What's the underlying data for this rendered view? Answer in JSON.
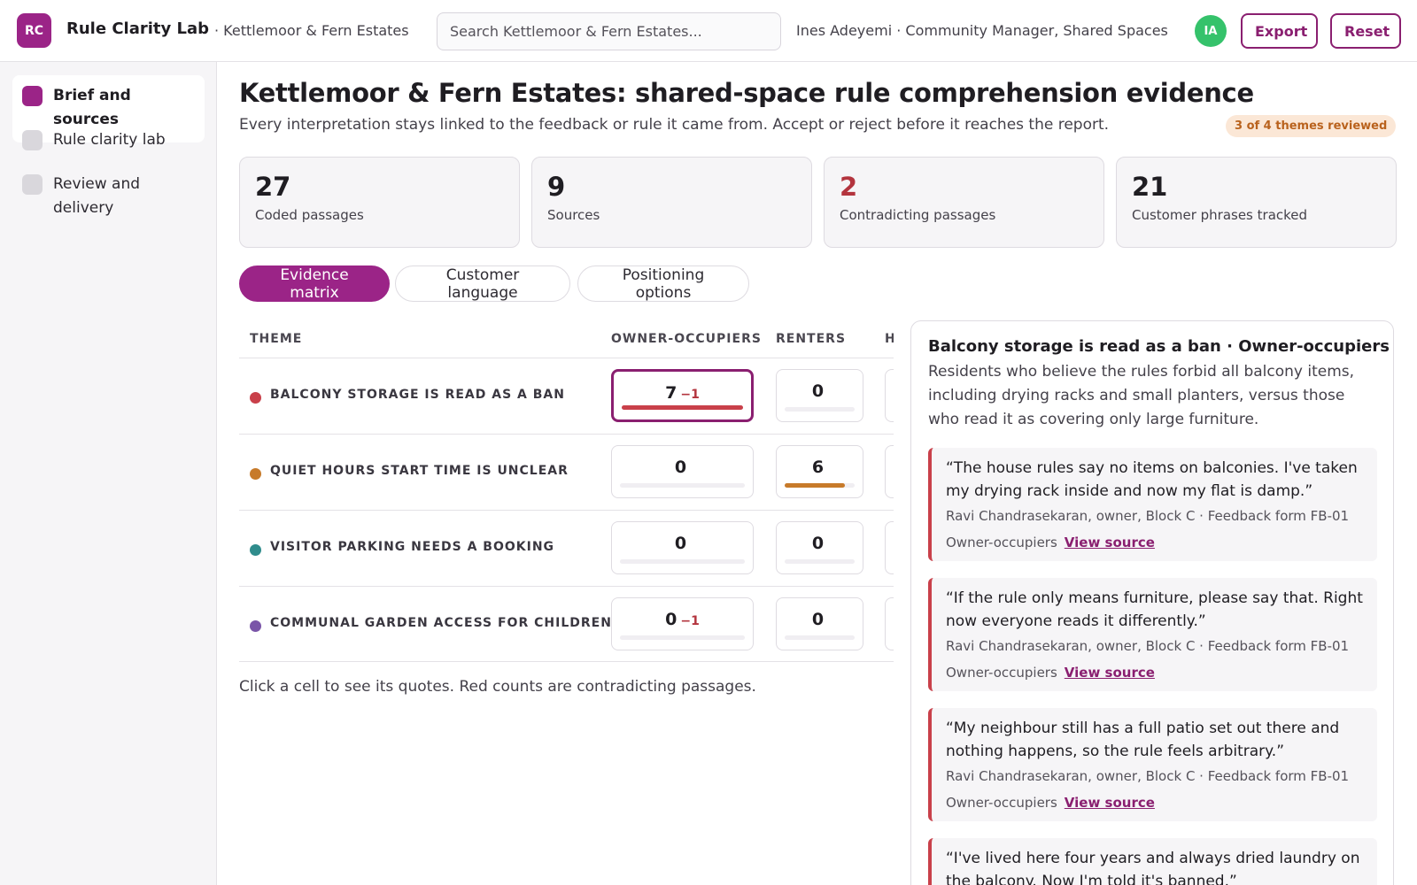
{
  "header": {
    "logo": "RC",
    "app_name": "Rule Clarity Lab",
    "workspace": "· Kettlemoor & Fern Estates",
    "search_placeholder": "Search Kettlemoor & Fern Estates...",
    "user": "Ines Adeyemi · Community Manager, Shared Spaces",
    "avatar": "IA",
    "export_label": "Export",
    "reset_label": "Reset"
  },
  "sidebar": {
    "items": [
      {
        "label": "Brief and sources",
        "active": true
      },
      {
        "label": "Rule clarity lab",
        "active": false
      },
      {
        "label": "Review and delivery",
        "active": false
      }
    ]
  },
  "main": {
    "title": "Kettlemoor & Fern Estates: shared-space rule comprehension evidence",
    "subtitle": "Every interpretation stays linked to the feedback or rule it came from. Accept or reject before it reaches the report.",
    "review_badge": "3 of 4 themes reviewed",
    "stats": [
      {
        "value": "27",
        "label": "Coded passages",
        "highlight": false
      },
      {
        "value": "9",
        "label": "Sources",
        "highlight": false
      },
      {
        "value": "2",
        "label": "Contradicting passages",
        "highlight": true
      },
      {
        "value": "21",
        "label": "Customer phrases tracked",
        "highlight": false
      }
    ],
    "tabs": [
      {
        "label": "Evidence matrix",
        "active": true
      },
      {
        "label": "Customer language",
        "active": false
      },
      {
        "label": "Positioning options",
        "active": false
      }
    ]
  },
  "matrix": {
    "headers": [
      "THEME",
      "OWNER-OCCUPIERS",
      "RENTERS",
      "H"
    ],
    "rows": [
      {
        "theme": "BALCONY STORAGE IS READ AS A BAN",
        "color": "#c9404a",
        "cells": [
          {
            "count": "7",
            "contra": "−1",
            "fill": 1.0,
            "selected": true
          },
          {
            "count": "0",
            "contra": "",
            "fill": 0,
            "selected": false
          }
        ]
      },
      {
        "theme": "QUIET HOURS START TIME IS UNCLEAR",
        "color": "#c77a2a",
        "cells": [
          {
            "count": "0",
            "contra": "",
            "fill": 0,
            "selected": false
          },
          {
            "count": "6",
            "contra": "",
            "fill": 0.86,
            "selected": false
          }
        ]
      },
      {
        "theme": "VISITOR PARKING NEEDS A BOOKING",
        "color": "#2f8c8c",
        "cells": [
          {
            "count": "0",
            "contra": "",
            "fill": 0,
            "selected": false
          },
          {
            "count": "0",
            "contra": "",
            "fill": 0,
            "selected": false
          }
        ]
      },
      {
        "theme": "COMMUNAL GARDEN ACCESS FOR CHILDREN",
        "color": "#7a55a8",
        "cells": [
          {
            "count": "0",
            "contra": "−1",
            "fill": 0,
            "selected": false
          },
          {
            "count": "0",
            "contra": "",
            "fill": 0,
            "selected": false
          }
        ]
      }
    ],
    "note": "Click a cell to see its quotes. Red counts are contradicting passages."
  },
  "detail": {
    "title": "Balcony storage is read as a ban · Owner-occupiers",
    "description": "Residents who believe the rules forbid all balcony items, including drying racks and small planters, versus those who read it as covering only large furniture.",
    "quotes": [
      {
        "text": "“The house rules say no items on balconies. I've taken my drying rack inside and now my flat is damp.”",
        "meta": "Ravi Chandrasekaran, owner, Block C · Feedback form FB-01",
        "segment": "Owner-occupiers",
        "link": "View source"
      },
      {
        "text": "“If the rule only means furniture, please say that. Right now everyone reads it differently.”",
        "meta": "Ravi Chandrasekaran, owner, Block C · Feedback form FB-01",
        "segment": "Owner-occupiers",
        "link": "View source"
      },
      {
        "text": "“My neighbour still has a full patio set out there and nothing happens, so the rule feels arbitrary.”",
        "meta": "Ravi Chandrasekaran, owner, Block C · Feedback form FB-01",
        "segment": "Owner-occupiers",
        "link": "View source"
      },
      {
        "text": "“I've lived here four years and always dried laundry on the balcony. Now I'm told it's banned.”",
        "meta": "",
        "segment": "",
        "link": ""
      }
    ]
  }
}
